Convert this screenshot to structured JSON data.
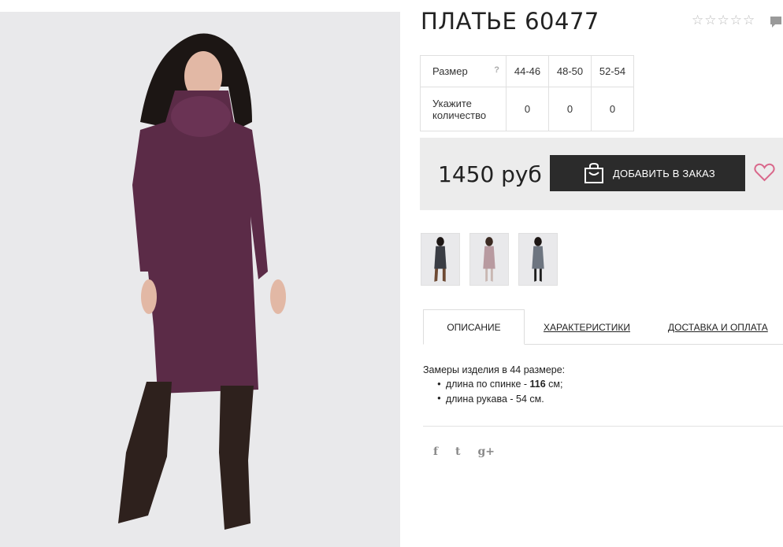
{
  "product": {
    "title": "ПЛАТЬЕ 60477",
    "rating_stars": 5,
    "rating_value": 0
  },
  "sizes": {
    "size_label": "Размер",
    "help_label": "?",
    "quantity_label": "Укажите количество",
    "columns": [
      "44-46",
      "48-50",
      "52-54"
    ],
    "quantities": [
      "0",
      "0",
      "0"
    ]
  },
  "purchase": {
    "price": "1450 руб",
    "add_button": "ДОБАВИТЬ В ЗАКАЗ"
  },
  "tabs": [
    {
      "label": "ОПИСАНИЕ",
      "active": true
    },
    {
      "label": "ХАРАКТЕРИСТИКИ",
      "active": false
    },
    {
      "label": "ДОСТАВКА И ОПЛАТА",
      "active": false
    }
  ],
  "description": {
    "intro": "Замеры изделия в 44 размере:",
    "items": [
      {
        "prefix": "длина по спинке - ",
        "bold": "116",
        "suffix": " см;"
      },
      {
        "prefix": "длина рукава - 54 см.",
        "bold": "",
        "suffix": ""
      }
    ]
  },
  "social": {
    "facebook": "f",
    "twitter": "t",
    "google": "g+"
  },
  "colors": {
    "dress_main": "#5b2b47",
    "boots": "#2e211d",
    "button_bg": "#2b2b2b",
    "heart": "#d9688b",
    "price_bg": "#ececec"
  }
}
